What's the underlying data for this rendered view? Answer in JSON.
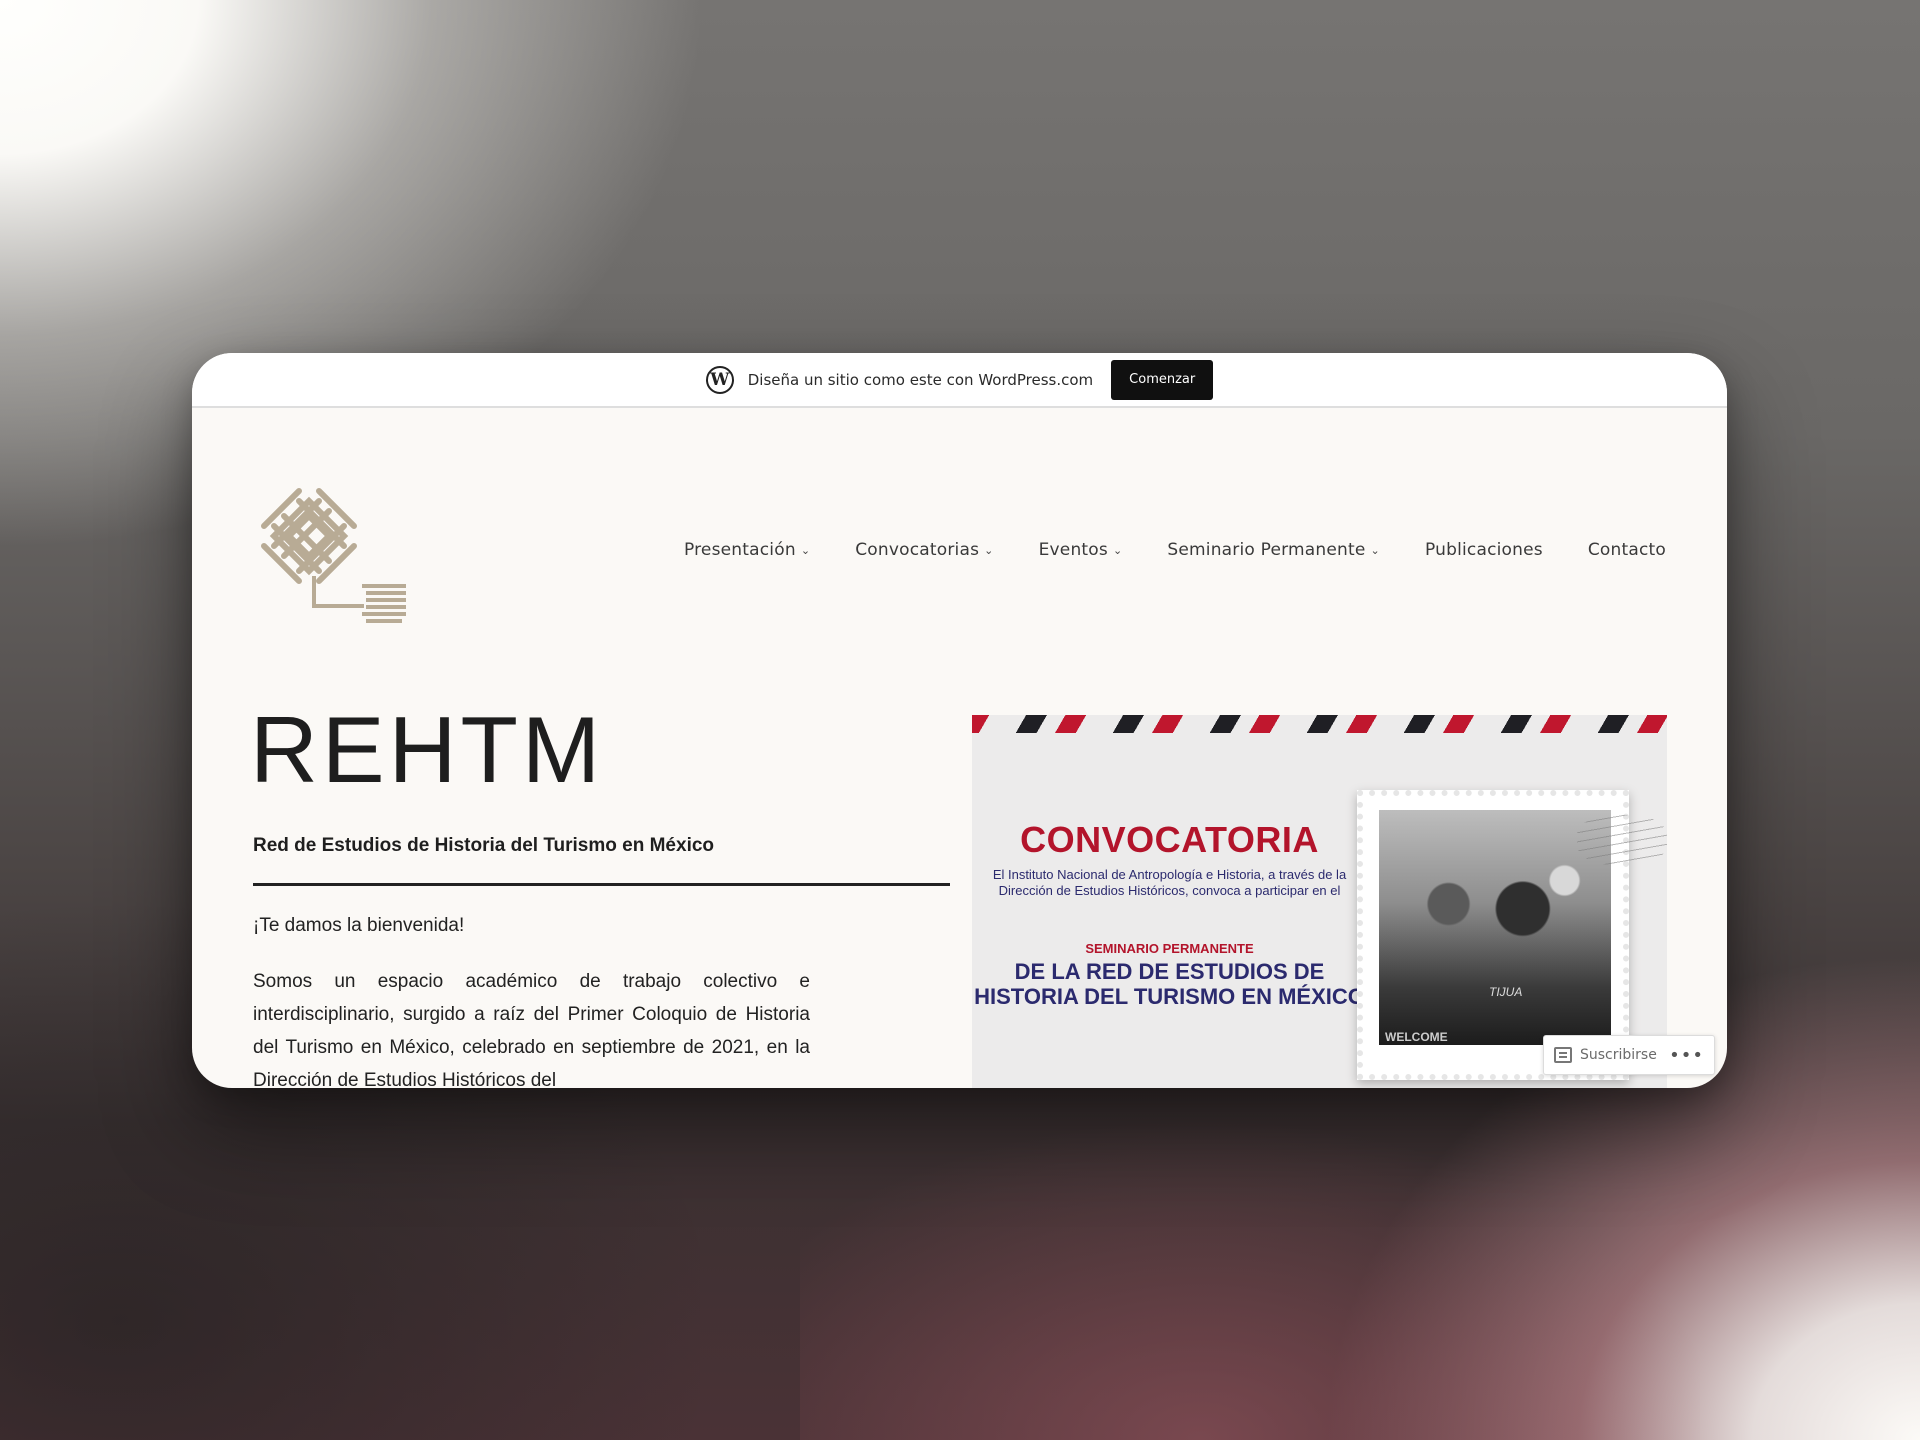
{
  "wp_bar": {
    "logo_letter": "W",
    "message": "Diseña un sitio como este con WordPress.com",
    "cta": "Comenzar"
  },
  "nav": {
    "items": [
      {
        "label": "Presentación",
        "has_dropdown": true
      },
      {
        "label": "Convocatorias",
        "has_dropdown": true
      },
      {
        "label": "Eventos",
        "has_dropdown": true
      },
      {
        "label": "Seminario Permanente",
        "has_dropdown": true
      },
      {
        "label": "Publicaciones",
        "has_dropdown": false
      },
      {
        "label": "Contacto",
        "has_dropdown": false
      }
    ],
    "chevron": "⌄"
  },
  "site": {
    "title": "REHTM",
    "tagline": "Red de Estudios de Historia del Turismo en México",
    "welcome": "¡Te damos la bienvenida!",
    "intro": "Somos un espacio académico de trabajo colectivo e interdisciplinario, surgido a raíz del Primer Coloquio de Historia del Turismo en México, celebrado en septiembre de 2021, en la Dirección de Estudios Históricos del"
  },
  "poster": {
    "heading": "CONVOCATORIA",
    "body": "El Instituto Nacional de Antropología e Historia, a través de la Dirección de Estudios Históricos, convoca a participar en el",
    "seminar_label": "SEMINARIO PERMANENTE",
    "seminar_title": "DE LA RED DE ESTUDIOS DE HISTORIA DEL TURISMO EN MÉXICO",
    "photo_text": "TIJUA",
    "photo_welcome": "WELCOME"
  },
  "subscribe": {
    "label": "Suscribirse",
    "more": "•••"
  },
  "colors": {
    "accent_red": "#b3142b",
    "accent_navy": "#2b2a6e",
    "logo_beige": "#b8ab95",
    "page_bg": "#fbf9f6"
  }
}
